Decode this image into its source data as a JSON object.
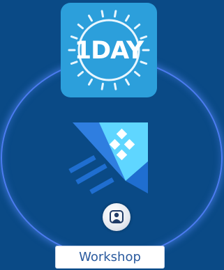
{
  "badge": {
    "text": "1DAY",
    "icon": "sun-icon"
  },
  "product": {
    "icon": "product-logo-icon"
  },
  "avatar": {
    "icon": "user-icon"
  },
  "label": {
    "text": "Workshop"
  },
  "colors": {
    "background": "#0a4a86",
    "ring": "#4c7cf0",
    "badge": "#2c9fdb",
    "label_text": "#2a5a9e"
  }
}
